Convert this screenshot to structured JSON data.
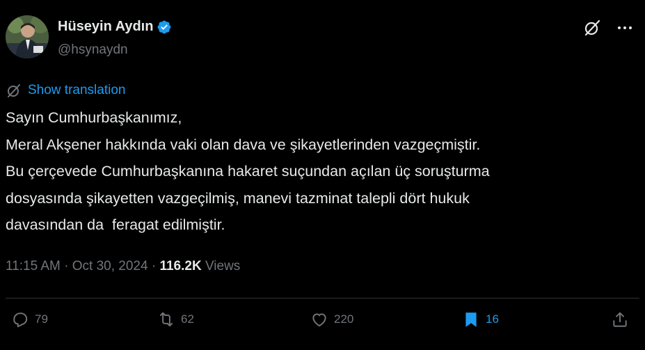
{
  "author": {
    "name": "Hüseyin Aydın",
    "handle": "@hsynaydn"
  },
  "translation": {
    "label": "Show translation"
  },
  "tweet": {
    "lines": [
      "Sayın Cumhurbaşkanımız,",
      "Meral Akşener hakkında vaki olan dava ve şikayetlerinden vazgeçmiştir.",
      "Bu çerçevede Cumhurbaşkanına hakaret suçundan açılan üç soruşturma",
      "dosyasında şikayetten vazgeçilmiş, manevi tazminat talepli dört hukuk",
      "davasından da  feragat edilmiştir."
    ]
  },
  "meta": {
    "time": "11:15 AM",
    "separator": " · ",
    "date": "Oct 30, 2024",
    "views_count": "116.2K",
    "views_label": " Views"
  },
  "actions": {
    "replies": "79",
    "reposts": "62",
    "likes": "220",
    "bookmarks": "16"
  },
  "colors": {
    "background": "#000000",
    "text": "#e7e9ea",
    "muted": "#71767b",
    "accent": "#1d9bf0",
    "divider": "#2f3336"
  },
  "icons": {
    "verified": "verified-badge-icon",
    "grok": "grok-icon",
    "more": "more-icon",
    "translate": "translate-icon",
    "reply": "reply-icon",
    "repost": "repost-icon",
    "like": "like-icon",
    "bookmark": "bookmark-icon",
    "share": "share-icon"
  }
}
